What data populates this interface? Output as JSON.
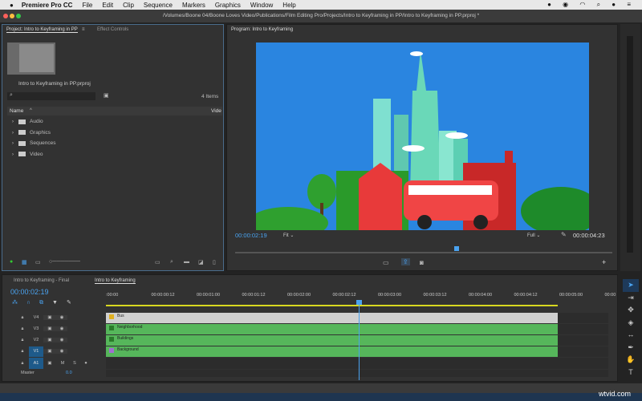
{
  "menubar": {
    "app": "Premiere Pro CC",
    "items": [
      "File",
      "Edit",
      "Clip",
      "Sequence",
      "Markers",
      "Graphics",
      "Window",
      "Help"
    ]
  },
  "window": {
    "title": "/Volumes/Boone 04/Boone Loves Video/Publications/Film Editing Pro/Projects/Intro to Keyframing in PP/Intro to Keyframing in PP.prproj *"
  },
  "project": {
    "tab": "Project: Intro to Keyframing in PP",
    "tab2": "Effect Controls",
    "filename": "Intro to Keyframing in PP.prproj",
    "search_placeholder": "",
    "item_count": "4 Items",
    "col_name": "Name",
    "col_video": "Vide",
    "items": [
      "Audio",
      "Graphics",
      "Sequences",
      "Video"
    ]
  },
  "program": {
    "tab": "Program: Intro to Keyframing",
    "timecode": "00:00:02:19",
    "fit": "Fit",
    "quality": "Full",
    "duration": "00:00:04:23",
    "playhead_fraction": 0.58
  },
  "timeline": {
    "tabs": [
      "Intro to Keyframing - Final",
      "Intro to Keyframing"
    ],
    "timecode": "00:00:02:19",
    "ruler": [
      ":00:00",
      "00:00:00:12",
      "00:00:01:00",
      "00:00:01:12",
      "00:00:02:00",
      "00:00:02:12",
      "00:00:03:00",
      "00:00:03:12",
      "00:00:04:00",
      "00:00:04:12",
      "00:00:05:00",
      "00:00"
    ],
    "tracks": [
      {
        "name": "V4",
        "clip": "Bus"
      },
      {
        "name": "V3",
        "clip": "Neighborhood"
      },
      {
        "name": "V2",
        "clip": "Buildings"
      },
      {
        "name": "V1",
        "clip": "Background"
      }
    ],
    "audio": {
      "name": "A1",
      "m": "M",
      "s": "S"
    },
    "master": {
      "name": "Master",
      "value": "0.0"
    }
  },
  "colors": {
    "accent": "#4aa3f0",
    "clip_green": "#56b65b",
    "clip_bus": "#d0d0d0",
    "sky": "#2a85e0"
  },
  "watermark": "wtvid.com"
}
